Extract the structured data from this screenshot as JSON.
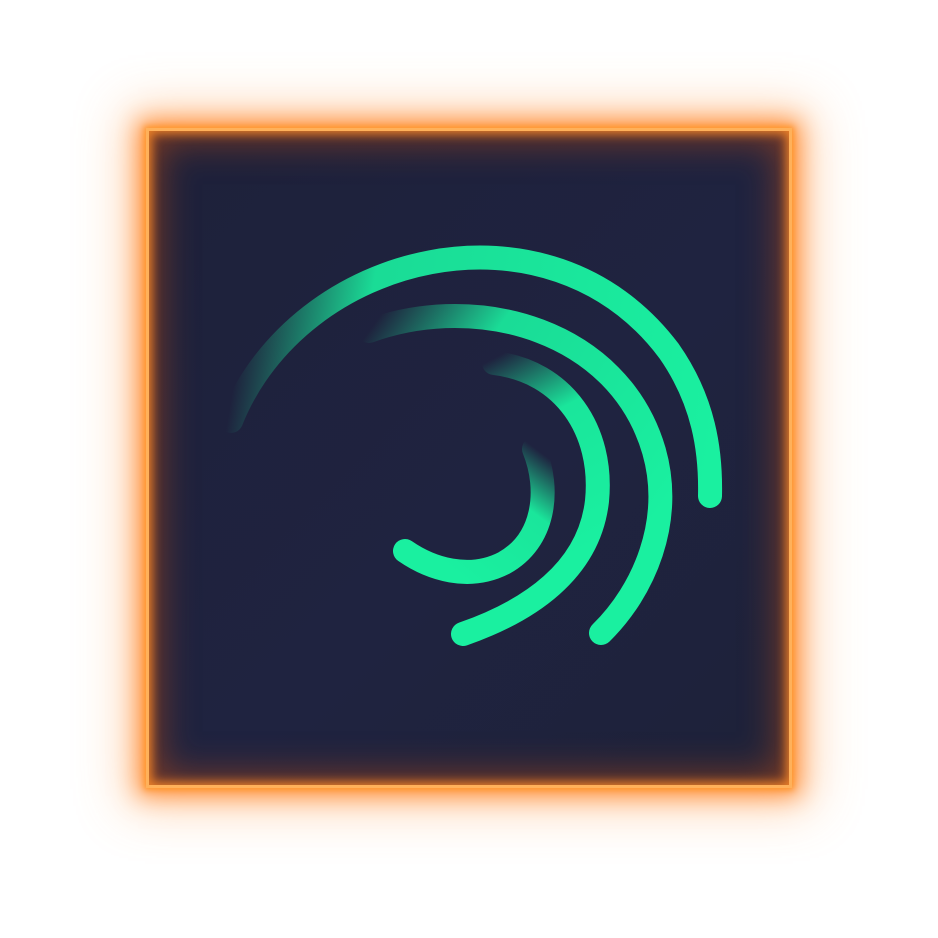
{
  "app_icon": {
    "background_color": "#1e2239",
    "glow_color": "#ff8a1e",
    "border_color": "#ffb15a",
    "arc_color": "#1af0a0",
    "logo_icon": "swirl-arcs-icon"
  }
}
